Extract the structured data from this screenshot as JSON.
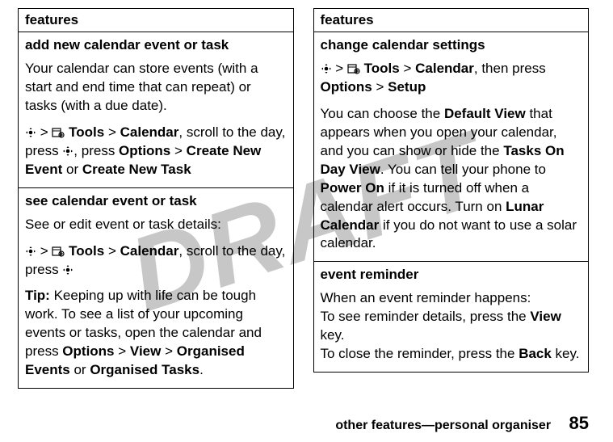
{
  "watermark": "DRAFT",
  "left": {
    "header": "features",
    "cells": [
      {
        "title": "add new calendar event or task",
        "p1": "Your calendar can store events (with a start and end time that can repeat) or tasks (with a due date).",
        "nav_tools": "Tools",
        "nav_calendar": "Calendar",
        "nav_tail1": ", scroll to the day, press ",
        "nav_tail2": ", press ",
        "options": "Options",
        "create_event": "Create New Event",
        "or": " or ",
        "create_task": "Create New Task",
        "gt": ">"
      },
      {
        "title": "see calendar event or task",
        "p1": "See or edit event or task details:",
        "nav_tools": "Tools",
        "nav_calendar": "Calendar",
        "nav_tail1": ", scroll to the day, press ",
        "gt": ">",
        "tip_label": "Tip:",
        "tip_text1": " Keeping up with life can be tough work. To see a list of your upcoming events or tasks, open the calendar and press ",
        "options": "Options",
        "view": "View",
        "org_events": "Organised Events",
        "or": " or ",
        "org_tasks": "Organised Tasks",
        "period": "."
      }
    ]
  },
  "right": {
    "header": "features",
    "cells": [
      {
        "title": "change calendar settings",
        "nav_tools": "Tools",
        "nav_calendar": "Calendar",
        "then_press": ", then press ",
        "options": "Options",
        "setup": "Setup",
        "gt": ">",
        "p2a": "You can choose the ",
        "default_view": "Default View",
        "p2b": " that appears when you open your calendar, and you can show or hide the ",
        "tasks_day": "Tasks On Day View",
        "p2c": ". You can tell your phone to ",
        "power_on": "Power On",
        "p2d": " if it is turned off when a calendar alert occurs. Turn on ",
        "lunar": "Lunar Calendar",
        "p2e": " if you do not want to use a solar calendar."
      },
      {
        "title": "event reminder",
        "l1": "When an event reminder happens:",
        "l2a": "To see reminder details, press the ",
        "view": "View",
        "l2b": " key.",
        "l3a": "To close the reminder, press the ",
        "back": "Back",
        "l3b": " key."
      }
    ]
  },
  "footer": {
    "text": "other features—personal organiser",
    "page": "85"
  }
}
